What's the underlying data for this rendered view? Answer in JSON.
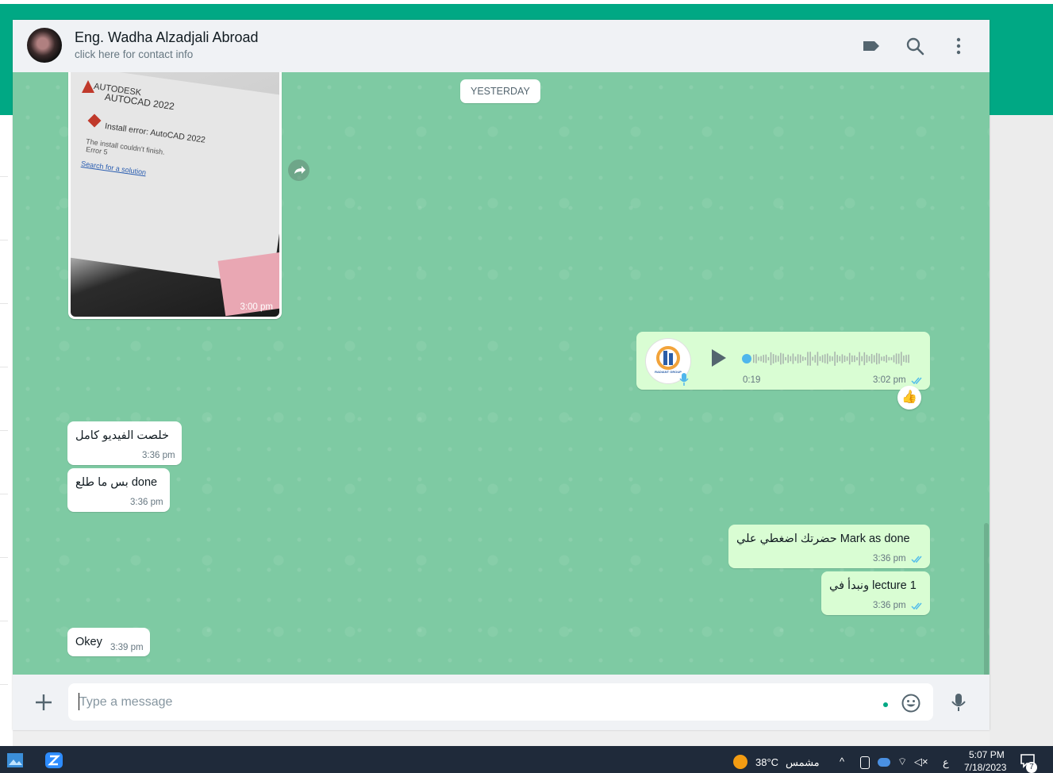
{
  "header": {
    "contact_name": "Eng. Wadha Alzadjali Abroad",
    "contact_sub": "click here for contact info"
  },
  "chat": {
    "date_pill": "YESTERDAY",
    "image_message": {
      "time": "3:00 pm",
      "screen_brand": "AUTODESK",
      "screen_product": "AUTOCAD 2022",
      "screen_error": "Install error: AutoCAD 2022",
      "screen_line1": "The install couldn't finish.",
      "screen_line2": "Error 5",
      "screen_link": "Search for a solution"
    },
    "voice_message": {
      "duration": "0:19",
      "time": "3:02 pm",
      "reaction": "👍",
      "avatar_caption": "RADIANT GROUP"
    },
    "incoming": [
      {
        "text": "خلصت الفيديو كامل",
        "time": "3:36 pm"
      },
      {
        "text": "بس ما طلع done",
        "time": "3:36 pm"
      },
      {
        "text": "Okey",
        "time": "3:39 pm"
      }
    ],
    "outgoing": [
      {
        "text": "حضرتك اضغطي علي Mark as done",
        "time": "3:36 pm"
      },
      {
        "text": "ونبدأ في lecture 1",
        "time": "3:36 pm"
      }
    ]
  },
  "composer": {
    "placeholder": "Type a message"
  },
  "taskbar": {
    "weather_temp": "38°C",
    "weather_label": "مشمس",
    "lang": "ع",
    "time": "5:07 PM",
    "date": "7/18/2023",
    "notifications": "7"
  },
  "colors": {
    "brand": "#00a884",
    "chat_bg": "#7ecaa3",
    "outgoing_bubble": "#d9fdd3",
    "tick_blue": "#53bdeb"
  }
}
